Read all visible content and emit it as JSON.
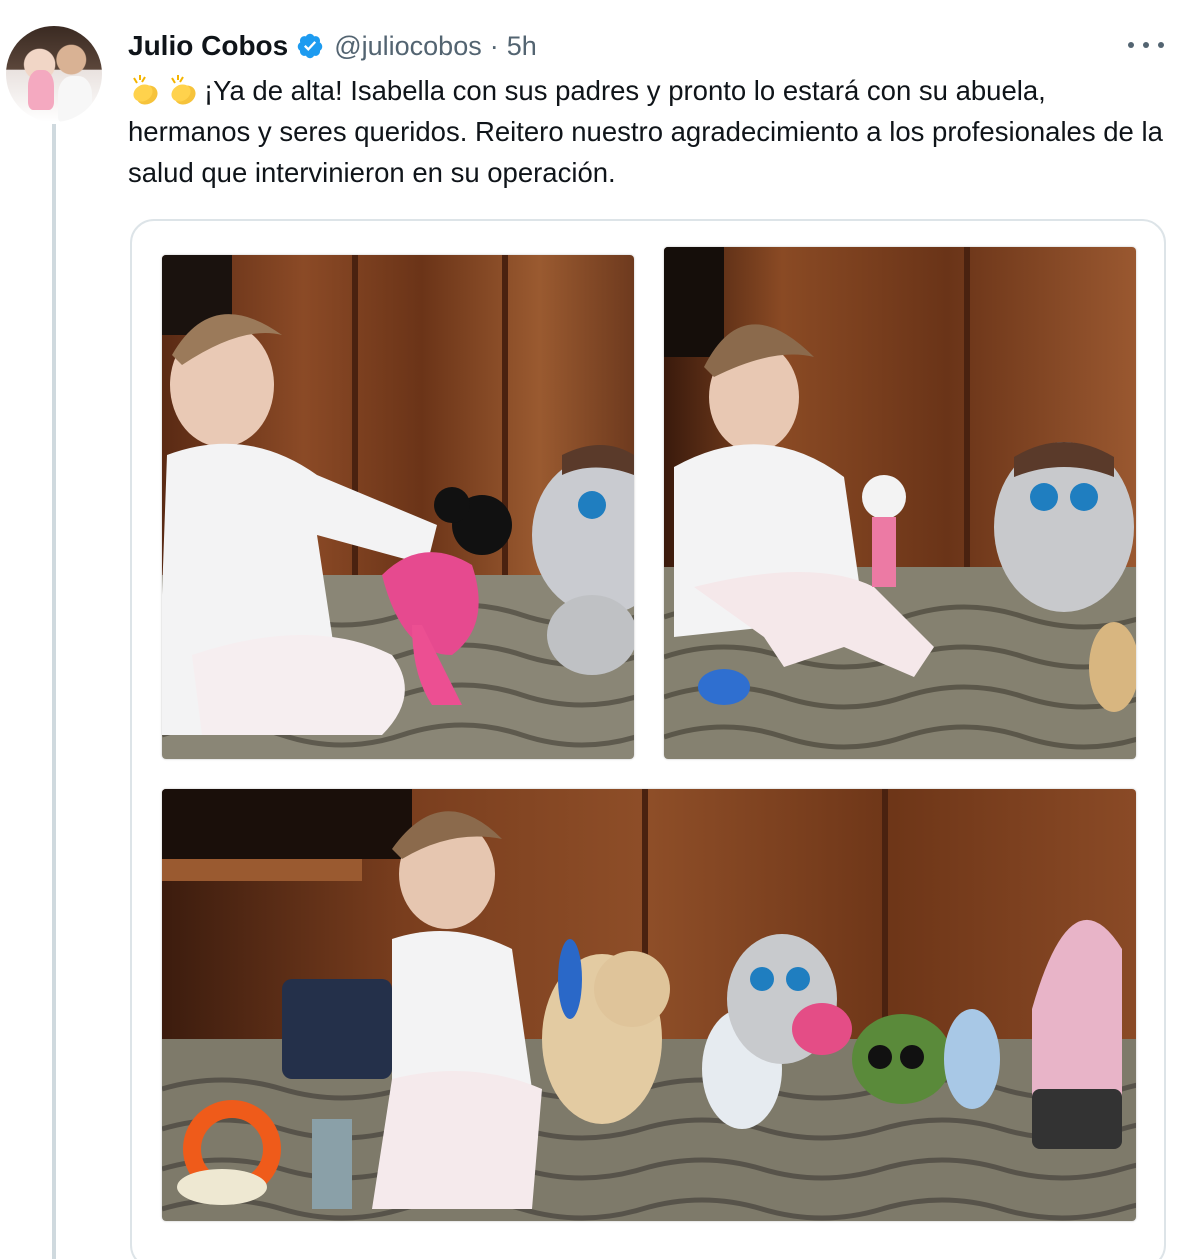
{
  "author": {
    "name": "Julio Cobos",
    "handle": "@juliocobos",
    "separator": "·",
    "time": "5h",
    "verified": true,
    "verified_color": "#1d9bf0"
  },
  "tweet": {
    "text": "¡Ya de alta! Isabella con sus padres y pronto lo estará con su abuela, hermanos y seres queridos. Reitero nuestro agradecimiento a los profesionales de la salud que intervinieron en su operación.",
    "leading_emoji": [
      "clapping-hands-icon",
      "clapping-hands-icon"
    ]
  },
  "icons": {
    "more": "more-options-icon",
    "verified": "verified-badge-icon"
  },
  "media": {
    "photo_count": 3
  }
}
